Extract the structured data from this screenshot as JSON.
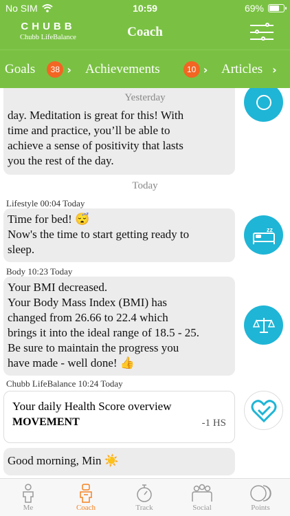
{
  "status_bar": {
    "carrier": "No SIM",
    "time": "10:59",
    "battery": "69%",
    "battery_level": 0.69
  },
  "header": {
    "brand_logo": "CHUBB",
    "brand_sub": "Chubb LifeBalance",
    "title": "Coach"
  },
  "tabs": [
    {
      "label": "Goals",
      "badge": "38"
    },
    {
      "label": "Achievements",
      "badge": "10"
    },
    {
      "label": "Articles"
    }
  ],
  "chat": {
    "divider_yesterday": "Yesterday",
    "msg1_lines": [
      "day. Meditation is great for this! With",
      "time and practice, you’ll be able to",
      "achieve a sense of positivity that lasts",
      "you the rest of the day."
    ],
    "divider_today": "Today",
    "msg2": {
      "meta": "Lifestyle 00:04 Today",
      "line1": "Time for bed! 😴",
      "lines": [
        "Now's the time to start getting ready to",
        "sleep."
      ]
    },
    "msg3": {
      "meta": "Body 10:23 Today",
      "lines": [
        "Your BMI decreased.",
        "Your Body Mass Index (BMI) has",
        "changed from 26.66 to 22.4 which",
        "brings it into the ideal range of 18.5 - 25.",
        "Be sure to maintain the progress you",
        "have made - well done! 👍"
      ]
    },
    "msg4": {
      "meta": "Chubb LifeBalance 10:24 Today",
      "title": "Your daily Health Score overview",
      "label": "MOVEMENT",
      "value": "-1 HS"
    },
    "msg5": {
      "text": "Good morning, Min ☀️"
    }
  },
  "bottom_nav": [
    {
      "label": "Me",
      "icon": "person-icon"
    },
    {
      "label": "Coach",
      "icon": "coach-icon",
      "active": true
    },
    {
      "label": "Track",
      "icon": "stopwatch-icon"
    },
    {
      "label": "Social",
      "icon": "group-icon"
    },
    {
      "label": "Points",
      "icon": "points-icon"
    }
  ],
  "colors": {
    "brand_green": "#7ac143",
    "badge_orange": "#f26522",
    "avatar_teal": "#1fb5d6",
    "active_orange": "#f58220"
  }
}
